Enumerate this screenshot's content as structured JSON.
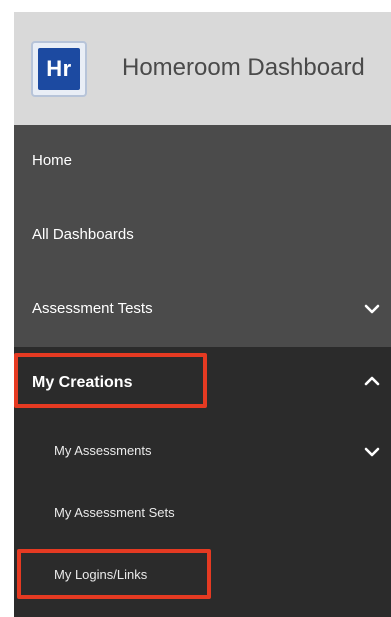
{
  "header": {
    "logo_text": "Hr",
    "app_title": "Homeroom Dashboard"
  },
  "nav": {
    "items": [
      {
        "label": "Home"
      },
      {
        "label": "All Dashboards"
      },
      {
        "label": "Assessment Tests",
        "chevron": "chevron-down-icon"
      }
    ],
    "my_creations": {
      "label": "My Creations",
      "chevron": "chevron-up-icon",
      "expanded": true,
      "highlighted": true,
      "subitems": [
        {
          "label": "My Assessments",
          "chevron": "chevron-down-icon"
        },
        {
          "label": "My Assessment Sets"
        },
        {
          "label": "My Logins/Links",
          "highlighted": true
        }
      ]
    }
  },
  "colors": {
    "header_bg": "#d9d9d9",
    "nav_bg": "#4b4b4b",
    "submenu_bg": "#2b2b2b",
    "logo_blue": "#1c4aa1",
    "highlight_red": "#e53a22"
  }
}
